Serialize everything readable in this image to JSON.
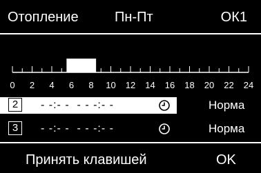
{
  "header": {
    "title": "Отопление",
    "days": "Пн-Пт",
    "circuit": "ОК1"
  },
  "timeline": {
    "hours": [
      "0",
      "2",
      "4",
      "6",
      "8",
      "10",
      "12",
      "14",
      "16",
      "18",
      "20",
      "22",
      "24"
    ],
    "active_period": {
      "start_hour": 5.5,
      "end_hour": 8.5
    }
  },
  "rows": [
    {
      "num": "2",
      "times": "- -:- -  - - -:- -",
      "mode": "Норма",
      "selected": true
    },
    {
      "num": "3",
      "times": "- -:- -  - - -:- -",
      "mode": "Норма",
      "selected": false
    }
  ],
  "footer": {
    "hint": "Принять клавишей",
    "ok": "OK"
  },
  "icons": {
    "clock": "clock-icon"
  }
}
